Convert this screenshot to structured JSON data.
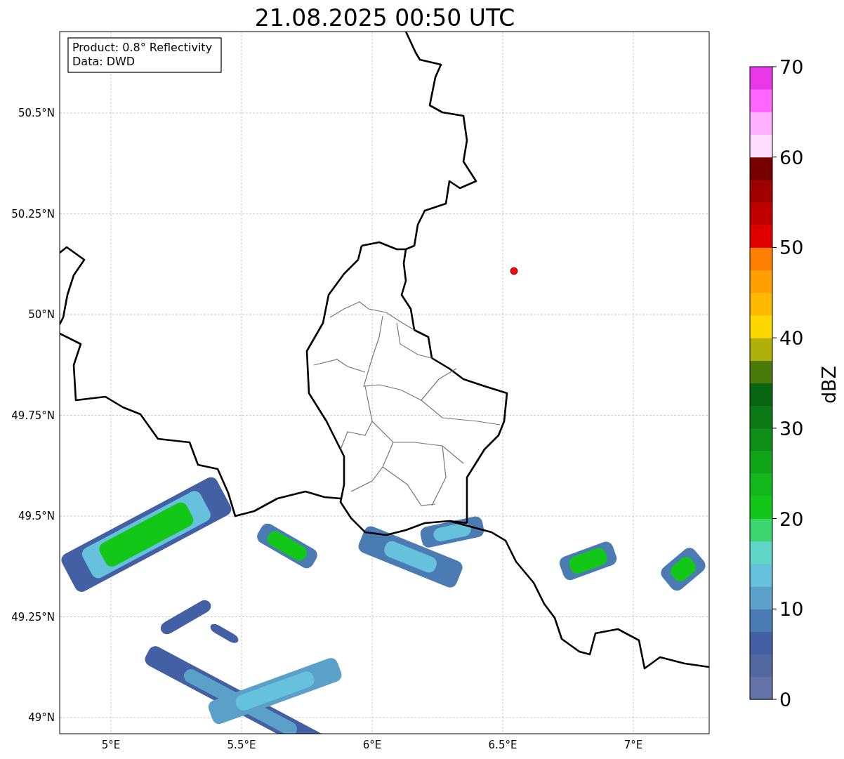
{
  "title": "21.08.2025 00:50 UTC",
  "info_box": [
    "Product: 0.8° Reflectivity",
    "Data: DWD"
  ],
  "map": {
    "lat_labels": [
      "50.5°N",
      "50.25°N",
      "50°N",
      "49.75°N",
      "49.5°N",
      "49.25°N",
      "49°N"
    ],
    "lon_labels": [
      "5°E",
      "5.5°E",
      "6°E",
      "6.5°E",
      "7°E"
    ]
  },
  "colorbar": {
    "label": "dBZ",
    "ticks": [
      "70",
      "60",
      "50",
      "40",
      "30",
      "20",
      "10",
      "0"
    ],
    "segments": [
      {
        "color": "#6473a8"
      },
      {
        "color": "#53689f"
      },
      {
        "color": "#4460a4"
      },
      {
        "color": "#4b7bb3"
      },
      {
        "color": "#5ba0c9"
      },
      {
        "color": "#66c1dd"
      },
      {
        "color": "#5fd6c6"
      },
      {
        "color": "#3dd570"
      },
      {
        "color": "#13c718"
      },
      {
        "color": "#12b81b"
      },
      {
        "color": "#10a418"
      },
      {
        "color": "#0e8d18"
      },
      {
        "color": "#0c7a14"
      },
      {
        "color": "#0a6512"
      },
      {
        "color": "#4a7a0a"
      },
      {
        "color": "#b0b00a"
      },
      {
        "color": "#ffd700"
      },
      {
        "color": "#ffb900"
      },
      {
        "color": "#ff9f00"
      },
      {
        "color": "#ff7f00"
      },
      {
        "color": "#e00000"
      },
      {
        "color": "#c00000"
      },
      {
        "color": "#a00000"
      },
      {
        "color": "#780000"
      },
      {
        "color": "#ffddff"
      },
      {
        "color": "#ffb0ff"
      },
      {
        "color": "#ff66ff"
      },
      {
        "color": "#e838e8"
      }
    ]
  }
}
